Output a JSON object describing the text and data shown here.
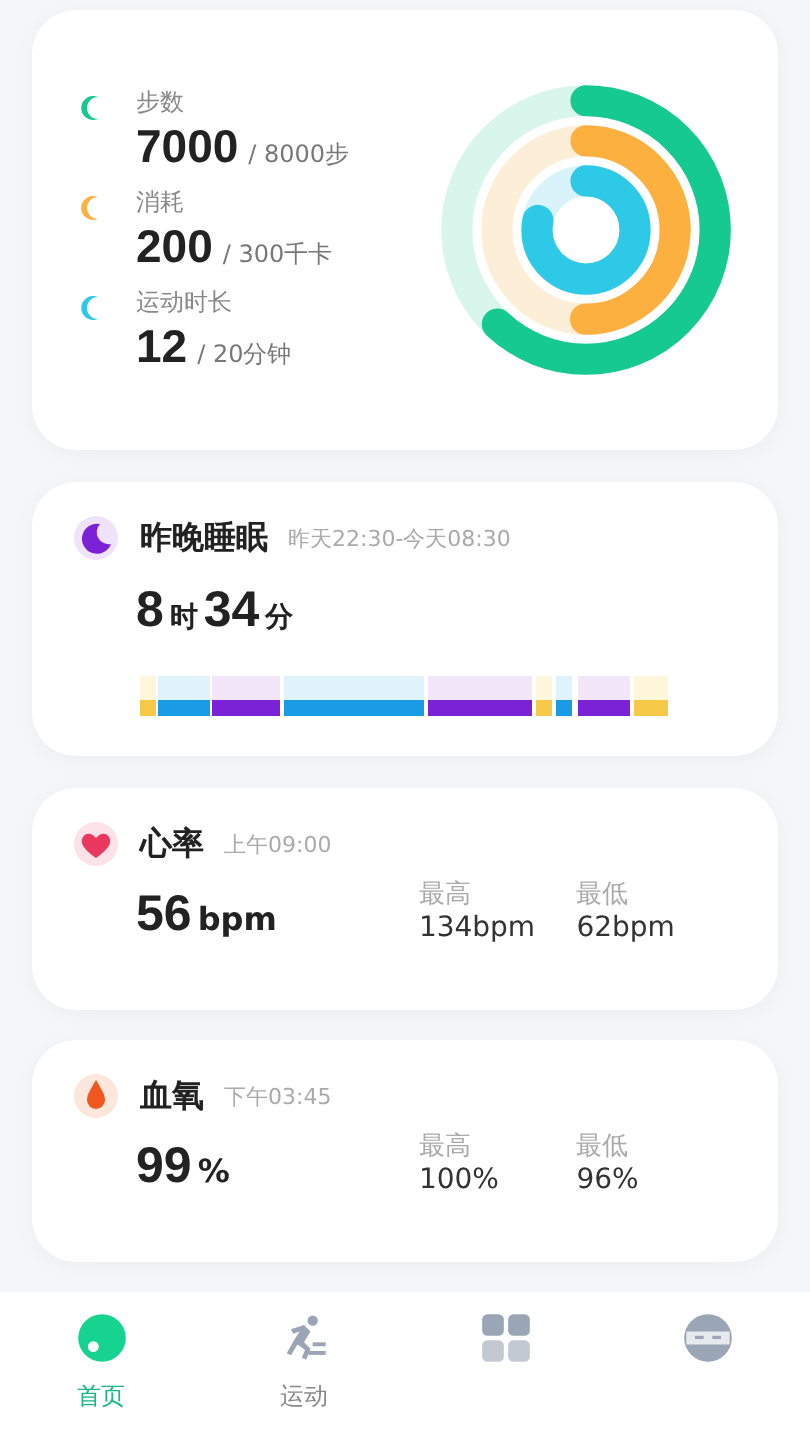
{
  "activity": {
    "metrics": [
      {
        "kind": "steps",
        "label": "步数",
        "value": "7000",
        "target": "/ 8000步"
      },
      {
        "kind": "calories",
        "label": "消耗",
        "value": "200",
        "target": "/ 300千卡"
      },
      {
        "kind": "duration",
        "label": "运动时长",
        "value": "12",
        "target": "/ 20分钟"
      }
    ]
  },
  "sleep": {
    "title": "昨晚睡眠",
    "time_range": "昨天22:30-今天08:30",
    "hours": "8",
    "hours_unit": "时",
    "minutes": "34",
    "minutes_unit": "分"
  },
  "vitals": [
    {
      "kind": "heart",
      "title": "心率",
      "time": "上午09:00",
      "value": "56",
      "unit": "bpm",
      "max_label": "最高",
      "max": "134bpm",
      "min_label": "最低",
      "min": "62bpm"
    },
    {
      "kind": "oxygen",
      "title": "血氧",
      "time": "下午03:45",
      "value": "99",
      "unit": "%",
      "max_label": "最高",
      "max": "100%",
      "min_label": "最低",
      "min": "96%"
    }
  ],
  "tab_bar": [
    {
      "kind": "home",
      "label": "首页",
      "selected": true
    },
    {
      "kind": "sport",
      "label": "运动",
      "selected": false
    },
    {
      "kind": "apps",
      "selected": false
    },
    {
      "kind": "profile",
      "selected": false
    }
  ]
}
